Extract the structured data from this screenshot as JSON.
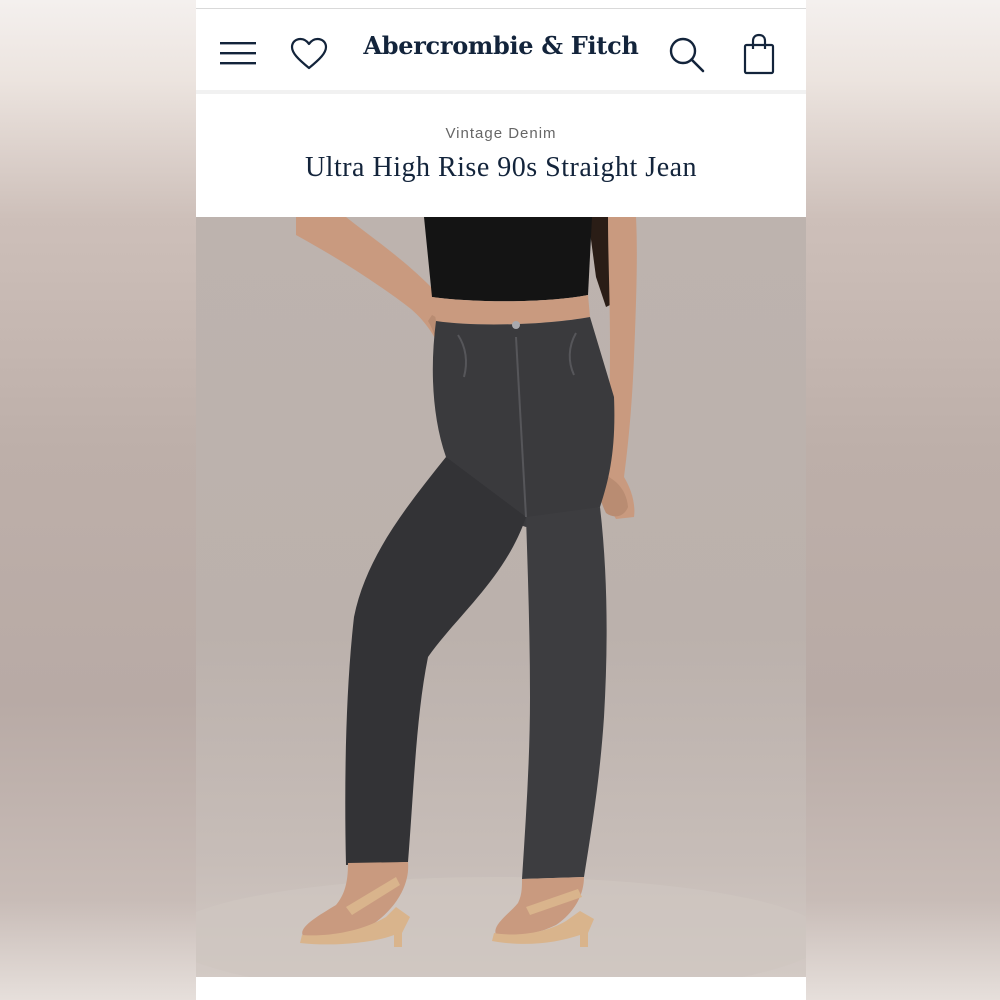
{
  "header": {
    "brand": "Abercrombie & Fitch",
    "icons": [
      "menu-icon",
      "heart-icon",
      "search-icon",
      "bag-icon"
    ]
  },
  "product": {
    "category": "Vintage Denim",
    "title": "Ultra High Rise 90s Straight Jean",
    "image_description_colors": {
      "top": "#141414",
      "denim": "#3a3a3d",
      "skin": "#c99a7f",
      "sandal": "#d9b48c"
    }
  },
  "colors": {
    "brand_navy": "#13243b",
    "background": "#ffffff"
  }
}
